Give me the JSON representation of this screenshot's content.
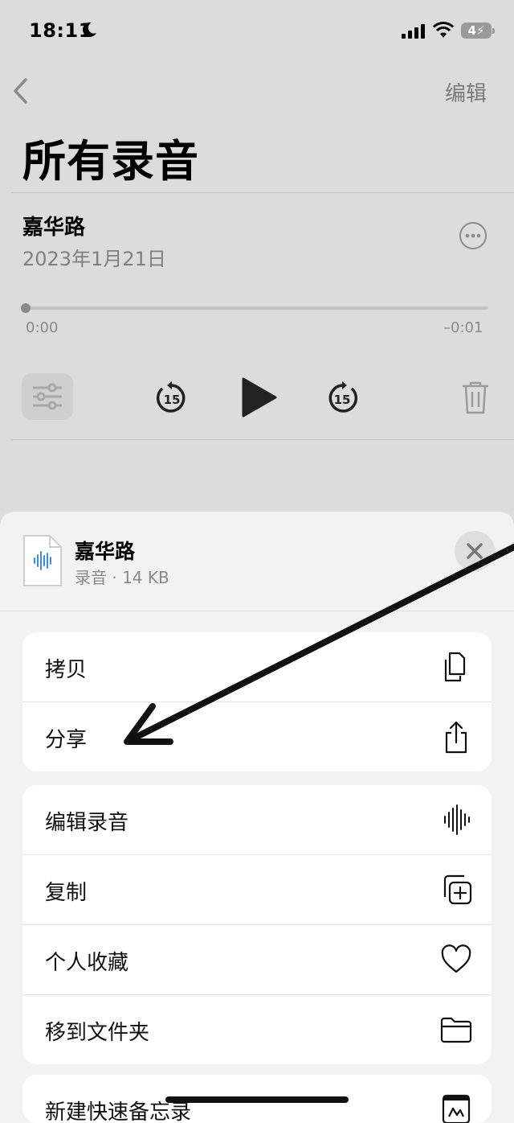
{
  "status_bar": {
    "time": "18:11",
    "battery": "4"
  },
  "header": {
    "edit_label": "编辑",
    "title": "所有录音"
  },
  "recording": {
    "name": "嘉华路",
    "date": "2023年1月21日",
    "elapsed": "0:00",
    "remaining": "–0:01",
    "progress": 0
  },
  "sheet": {
    "file_name": "嘉华路",
    "file_meta": "录音 · 14 KB",
    "groups": [
      [
        {
          "label": "拷贝",
          "icon": "copy-icon"
        },
        {
          "label": "分享",
          "icon": "share-icon"
        }
      ],
      [
        {
          "label": "编辑录音",
          "icon": "waveform-icon"
        },
        {
          "label": "复制",
          "icon": "duplicate-icon"
        },
        {
          "label": "个人收藏",
          "icon": "heart-icon"
        },
        {
          "label": "移到文件夹",
          "icon": "folder-icon"
        }
      ],
      [
        {
          "label": "新建快速备忘录",
          "icon": "quick-note-icon"
        }
      ]
    ]
  }
}
